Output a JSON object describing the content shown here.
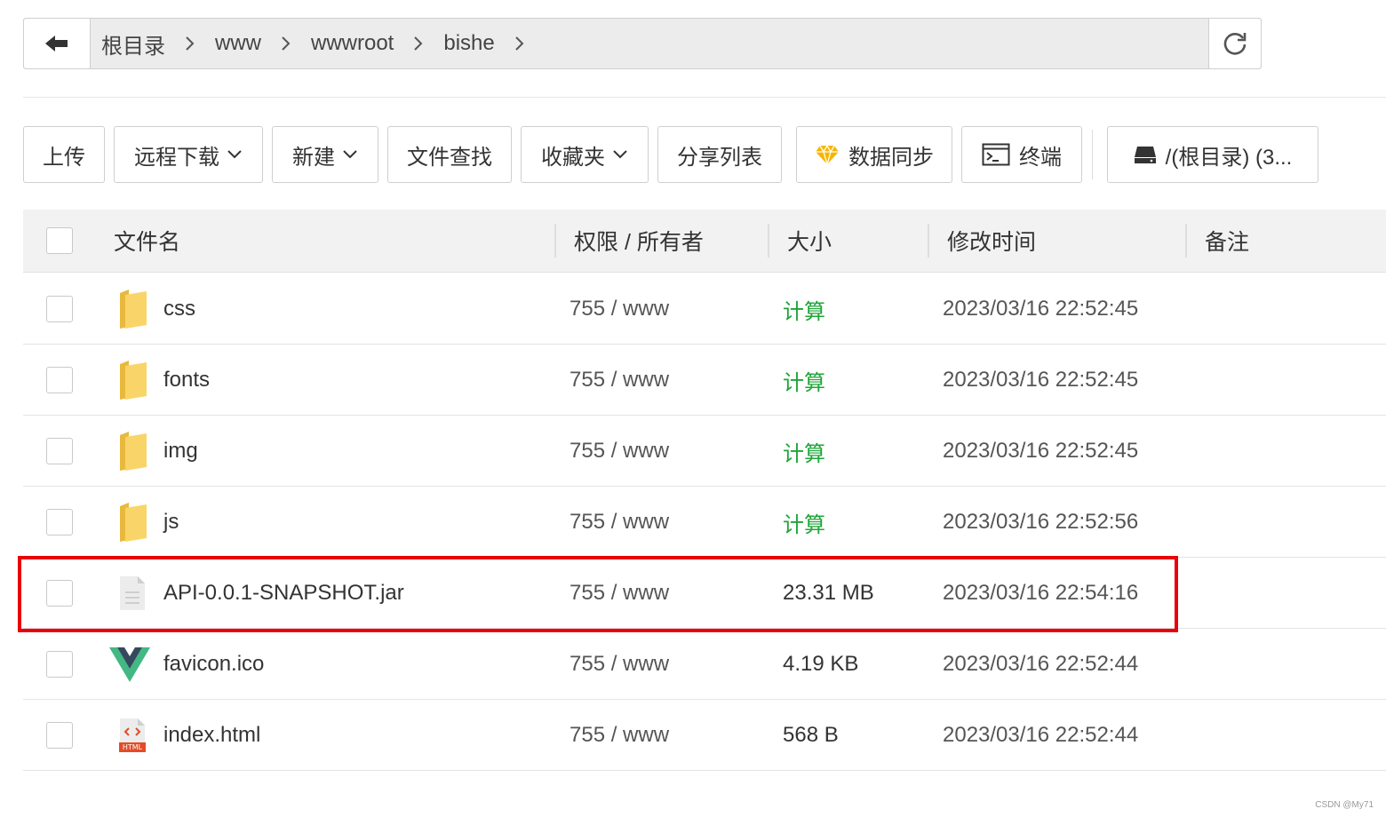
{
  "breadcrumb": [
    "根目录",
    "www",
    "wwwroot",
    "bishe"
  ],
  "toolbar": {
    "upload": "上传",
    "remote_download": "远程下载",
    "new": "新建",
    "file_search": "文件查找",
    "favorites": "收藏夹",
    "share_list": "分享列表",
    "data_sync": "数据同步",
    "terminal": "终端",
    "disk": "/(根目录) (3..."
  },
  "table": {
    "headers": {
      "name": "文件名",
      "perm": "权限 / 所有者",
      "size": "大小",
      "mtime": "修改时间",
      "note": "备注"
    },
    "rows": [
      {
        "name": "css",
        "type": "folder",
        "perm": "755 / www",
        "size": "计算",
        "mtime": "2023/03/16 22:52:45"
      },
      {
        "name": "fonts",
        "type": "folder",
        "perm": "755 / www",
        "size": "计算",
        "mtime": "2023/03/16 22:52:45"
      },
      {
        "name": "img",
        "type": "folder",
        "perm": "755 / www",
        "size": "计算",
        "mtime": "2023/03/16 22:52:45"
      },
      {
        "name": "js",
        "type": "folder",
        "perm": "755 / www",
        "size": "计算",
        "mtime": "2023/03/16 22:52:56"
      },
      {
        "name": "API-0.0.1-SNAPSHOT.jar",
        "type": "file",
        "perm": "755 / www",
        "size": "23.31 MB",
        "mtime": "2023/03/16 22:54:16"
      },
      {
        "name": "favicon.ico",
        "type": "vue",
        "perm": "755 / www",
        "size": "4.19 KB",
        "mtime": "2023/03/16 22:52:44"
      },
      {
        "name": "index.html",
        "type": "html",
        "perm": "755 / www",
        "size": "568 B",
        "mtime": "2023/03/16 22:52:44"
      }
    ]
  },
  "html_badge": "HTML",
  "watermark": "CSDN @My71",
  "colors": {
    "calc": "#20a53a",
    "highlight": "#e8000b"
  }
}
